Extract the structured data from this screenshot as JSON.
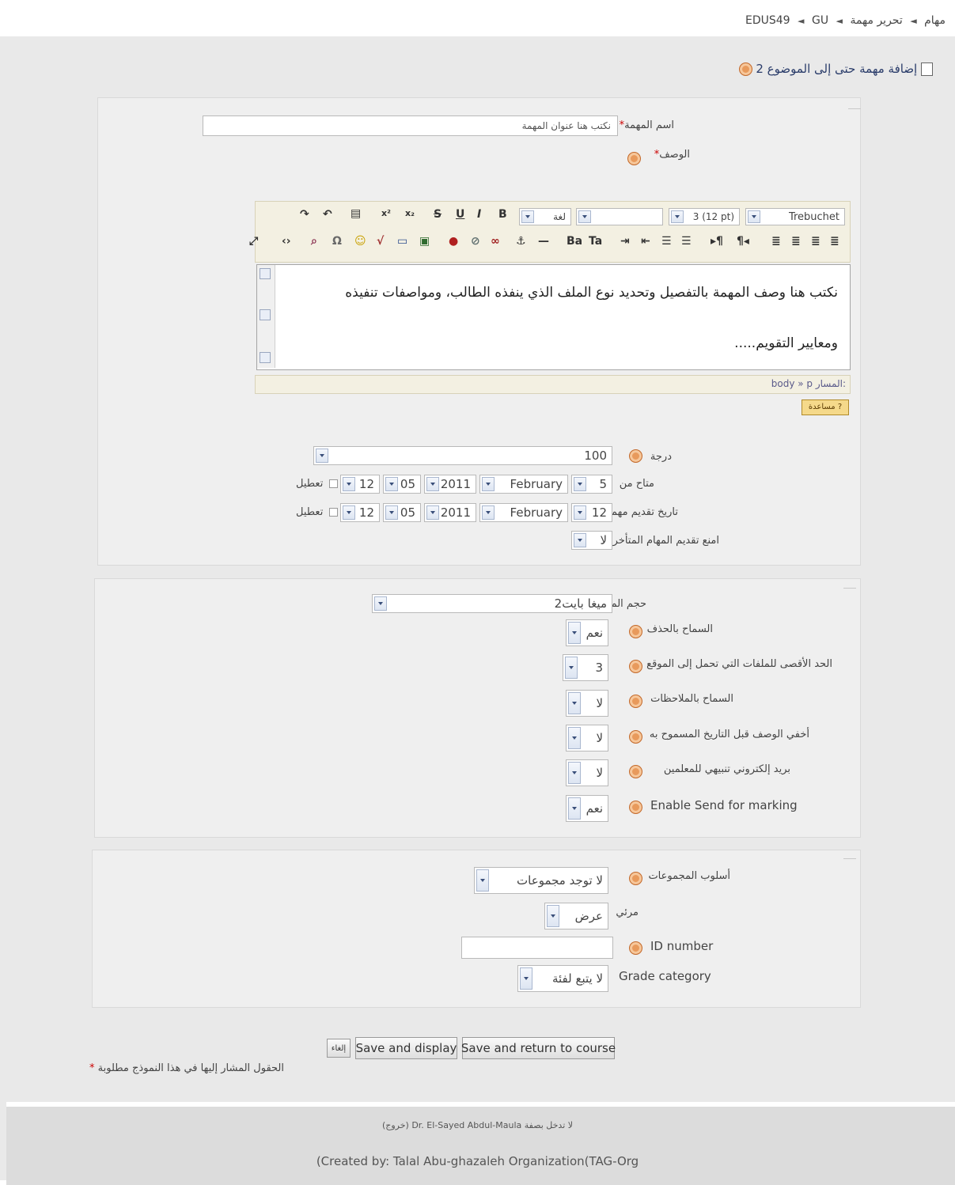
{
  "breadcrumb": {
    "items": [
      "EDUS49",
      "GU",
      "مهام",
      "تحرير مهمة"
    ],
    "separator": "◄"
  },
  "heading": "إضافة مهمة حتى إلى الموضوع 2",
  "general": {
    "name_label": "اسم المهمة",
    "name_value": "نكتب هنا عنوان المهمة",
    "required_mark": "*",
    "description_label": "الوصف",
    "editor": {
      "font_family": "Trebuchet",
      "font_size": "3 (12 pt)",
      "lang": "لغة",
      "content_line1": "نكتب هنا وصف المهمة بالتفصيل وتحديد نوع الملف الذي ينفذه الطالب، ومواصفات تنفيذه",
      "content_line2": "ومعايير التقويم.....",
      "path_label": "المسار:",
      "path_value": "body » p",
      "help_badge": "? مساعدة"
    },
    "grade_label": "درجة",
    "grade_value": "100",
    "available_label": "متاح من",
    "available": {
      "day": "5",
      "month": "February",
      "year": "2011",
      "hour": "05",
      "minute": "12",
      "disable_label": "تعطيل"
    },
    "due_label": "تاريخ تقديم مهمة",
    "due": {
      "day": "12",
      "month": "February",
      "year": "2011",
      "hour": "05",
      "minute": "12",
      "disable_label": "تعطيل"
    },
    "prevent_late_label": "امنع تقديم المهام المتأخر",
    "prevent_late_value": "لا"
  },
  "upload": {
    "max_size_label": "حجم الملف",
    "max_size_value": "2ميغا بايت",
    "allow_delete_label": "السماح بالحذف",
    "allow_delete_value": "نعم",
    "max_files_label": "الحد الأقصى للملفات التي تحمل إلى الموقع",
    "max_files_value": "3",
    "allow_notes_label": "السماح بالملاحظات",
    "allow_notes_value": "لا",
    "hide_desc_label": "أخفي الوصف قبل التاريخ المسموح به",
    "hide_desc_value": "لا",
    "email_label": "بريد إلكتروني تنبيهي للمعلمين",
    "email_value": "لا",
    "send_marking_label": "Enable Send for marking",
    "send_marking_value": "نعم"
  },
  "common": {
    "group_mode_label": "أسلوب المجموعات",
    "group_mode_value": "لا توجد مجموعات",
    "visible_label": "مرئي",
    "visible_value": "عرض",
    "id_number_label": "ID number",
    "id_number_value": "",
    "grade_category_label": "Grade category",
    "grade_category_value": "لا يتبع لفئة"
  },
  "buttons": {
    "save_return": "Save and return to course",
    "save_display": "Save and display",
    "cancel": "إلغاء"
  },
  "required_note": "الحقول المشار إليها في هذا النموذج مطلوبة",
  "footer": {
    "login_line": "لا تدخل بصفة Dr. El-Sayed Abdul-Maula (خروج)",
    "created_by": "(Created by: Talal Abu-ghazaleh Organization(TAG-Org"
  },
  "colors": {
    "page_bg": "#e9e9e9",
    "fieldset_bg": "#efefef",
    "heading": "#2a3c6a",
    "required": "#cc0000",
    "help_icon": "#e89a5c",
    "editor_toolbar": "#f3f0e2"
  }
}
